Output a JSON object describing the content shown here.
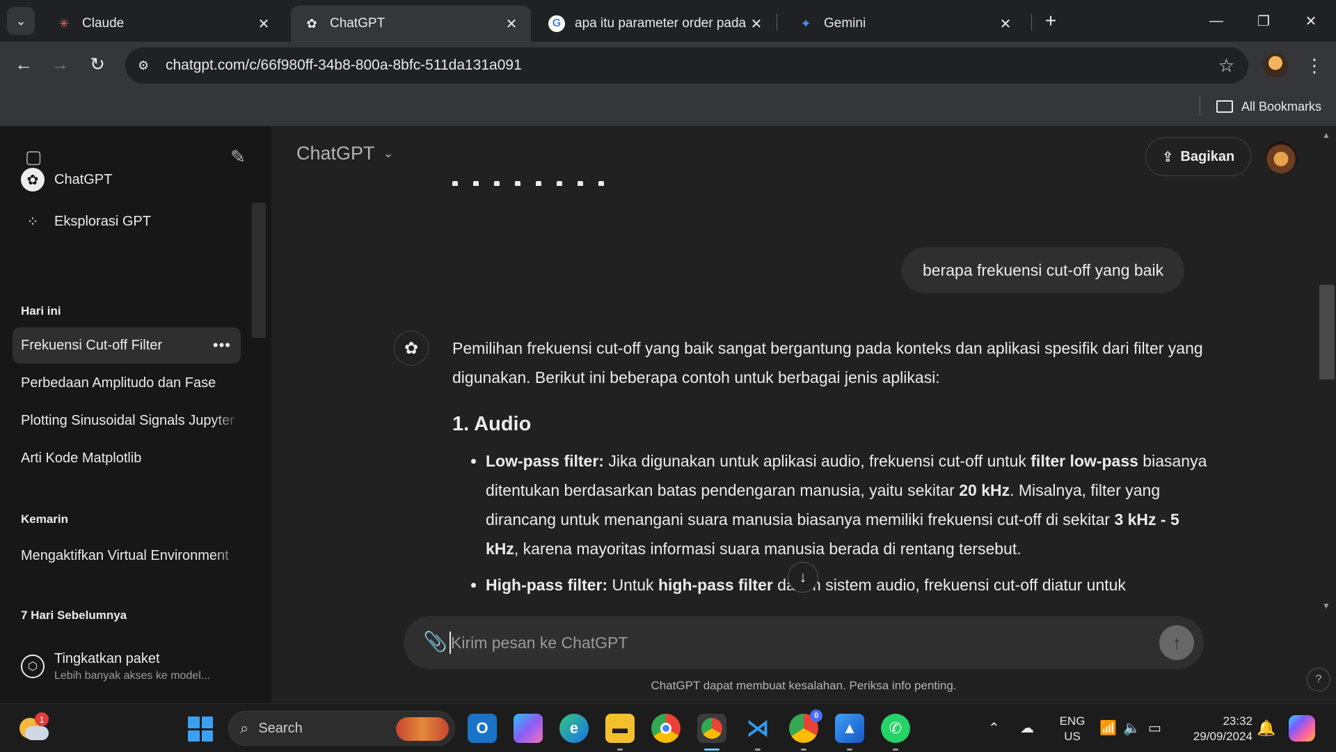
{
  "browser": {
    "tabs": [
      {
        "title": "Claude",
        "icon": "claude-icon"
      },
      {
        "title": "ChatGPT",
        "icon": "chatgpt-icon",
        "active": true
      },
      {
        "title": "apa itu parameter order pada s",
        "icon": "google-icon"
      },
      {
        "title": "Gemini",
        "icon": "gemini-icon"
      }
    ],
    "url": "chatgpt.com/c/66f980ff-34b8-800a-8bfc-511da131a091",
    "bookmarks_label": "All Bookmarks"
  },
  "sidebar": {
    "top_items": [
      {
        "label": "ChatGPT",
        "icon": "chatgpt-logo-icon"
      },
      {
        "label": "Eksplorasi GPT",
        "icon": "grid-icon"
      }
    ],
    "sections": [
      {
        "heading": "Hari ini",
        "items": [
          "Frekuensi Cut-off Filter",
          "Perbedaan Amplitudo dan Fase",
          "Plotting Sinusoidal Signals Jupyter",
          "Arti Kode Matplotlib"
        ]
      },
      {
        "heading": "Kemarin",
        "items": [
          "Mengaktifkan Virtual Environment"
        ]
      },
      {
        "heading": "7 Hari Sebelumnya",
        "items": []
      }
    ],
    "upgrade": {
      "title": "Tingkatkan paket",
      "subtitle": "Lebih banyak akses ke model..."
    }
  },
  "main": {
    "model_label": "ChatGPT",
    "share_label": "Bagikan",
    "user_message": "berapa frekuensi cut-off yang baik",
    "answer": {
      "intro": "Pemilihan frekuensi cut-off yang baik sangat bergantung pada konteks dan aplikasi spesifik dari filter yang digunakan. Berikut ini beberapa contoh untuk berbagai jenis aplikasi:",
      "heading": "1. Audio",
      "lp_label": "Low-pass filter:",
      "lp_t1": " Jika digunakan untuk aplikasi audio, frekuensi cut-off untuk ",
      "lp_b1": "filter low-pass",
      "lp_t2": " biasanya ditentukan berdasarkan batas pendengaran manusia, yaitu sekitar ",
      "lp_b2": "20 kHz",
      "lp_t3": ". Misalnya, filter yang dirancang untuk menangani suara manusia biasanya memiliki frekuensi cut-off di sekitar ",
      "lp_b3": "3 kHz - 5 kHz",
      "lp_t4": ", karena mayoritas informasi suara manusia berada di rentang tersebut.",
      "hp_label": "High-pass filter:",
      "hp_t1": " Untuk ",
      "hp_b1": "high-pass filter",
      "hp_t2": " dalam sistem audio, frekuensi cut-off diatur untuk"
    },
    "composer_placeholder": "Kirim pesan ke ChatGPT",
    "footer_note": "ChatGPT dapat membuat kesalahan. Periksa info penting.",
    "help_label": "?"
  },
  "taskbar": {
    "weather_badge": "1",
    "search_label": "Search",
    "lang_line1": "ENG",
    "lang_line2": "US",
    "time": "23:32",
    "date": "29/09/2024",
    "chrome_badge": "0"
  }
}
